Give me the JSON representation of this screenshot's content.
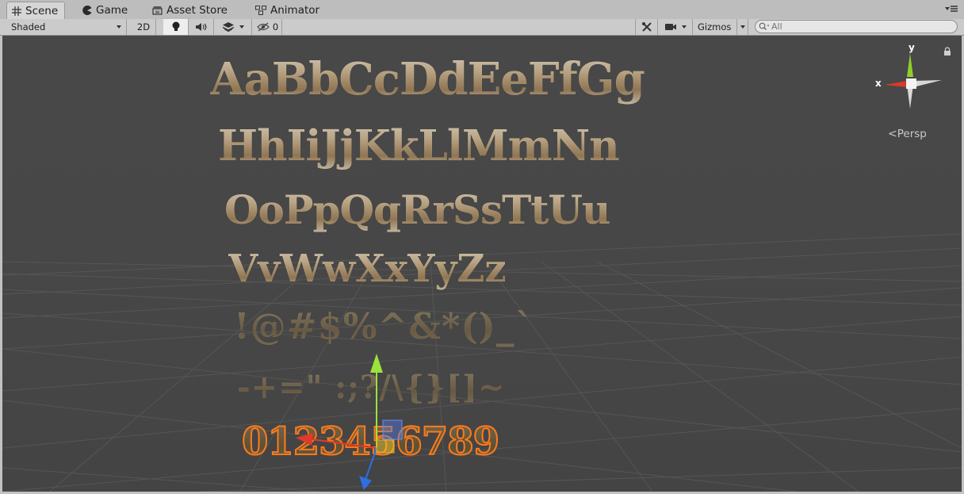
{
  "tabs": [
    {
      "label": "Scene",
      "icon": "grid-icon",
      "active": true
    },
    {
      "label": "Game",
      "icon": "pacman-icon",
      "active": false
    },
    {
      "label": "Asset Store",
      "icon": "store-icon",
      "active": false
    },
    {
      "label": "Animator",
      "icon": "animator-icon",
      "active": false
    }
  ],
  "toolbar": {
    "shading_mode": "Shaded",
    "mode_2d": "2D",
    "hidden_count": "0",
    "gizmos_label": "Gizmos",
    "search_placeholder": "All"
  },
  "viewport": {
    "rows": [
      "AaBbCcDdEeFfGg",
      "HhIiJjKkLlMmNn",
      "OoPpQqRrSsTtUu",
      "VvWwXxYyZz",
      "!@#$%^&*()_`",
      "-+=\" :;?/\\{}[]~",
      "0123456789"
    ],
    "gizmo": {
      "x_label": "x",
      "y_label": "y",
      "projection": "Persp"
    }
  },
  "colors": {
    "viewport_bg": "#474747",
    "axis_x": "#e03a2a",
    "axis_y": "#9be33a",
    "axis_z": "#2e6fe0",
    "selection_outline": "#ff7a1a"
  }
}
